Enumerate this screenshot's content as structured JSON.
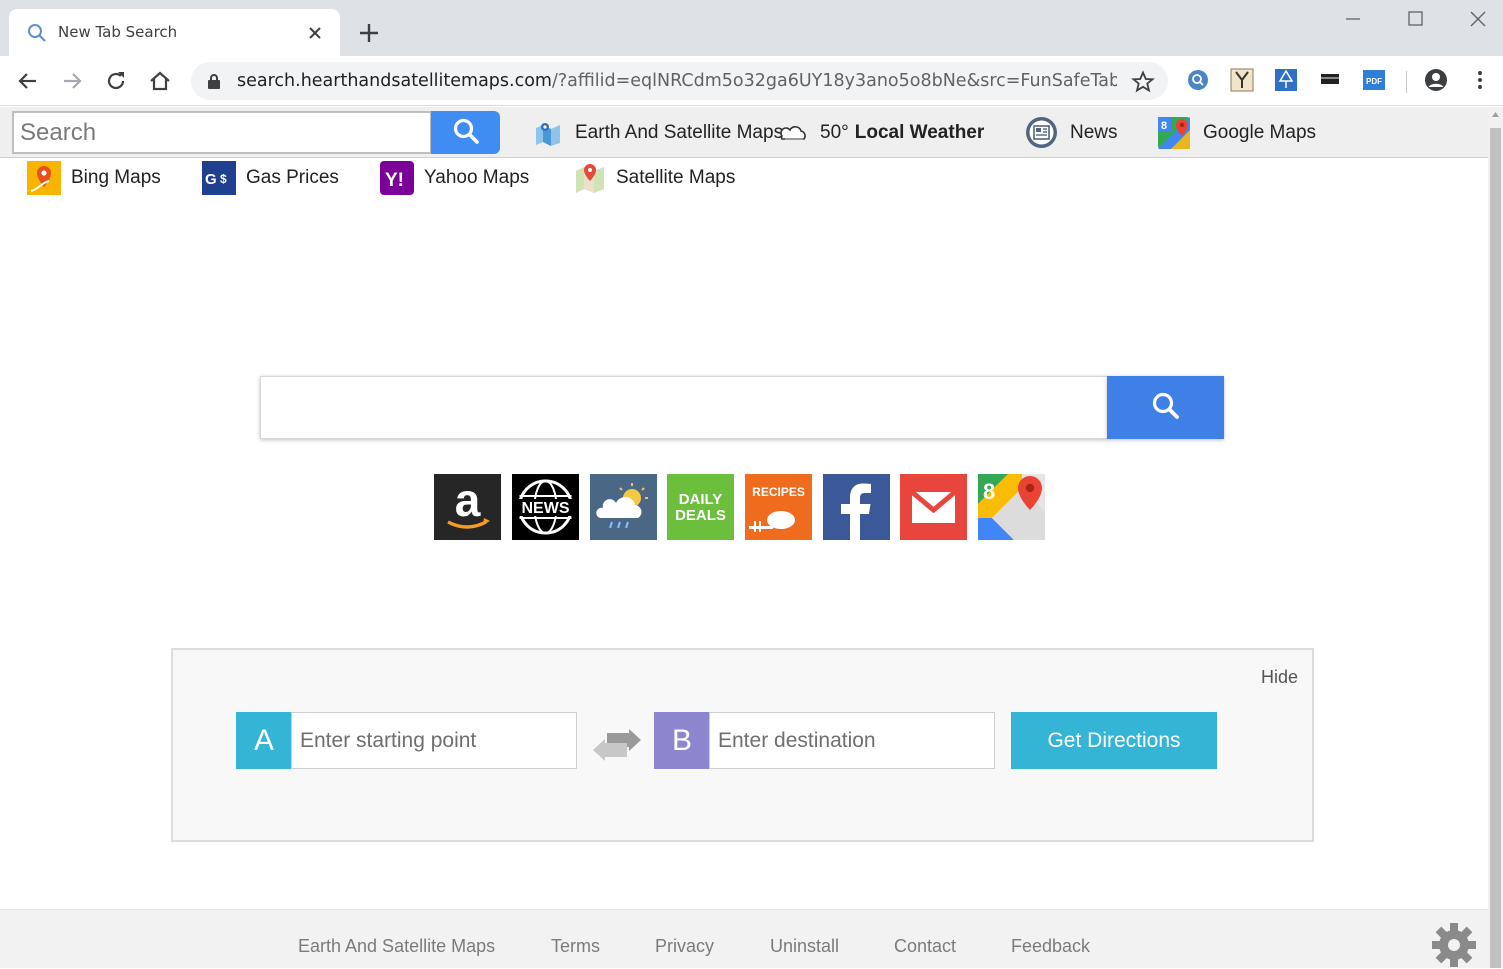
{
  "browser": {
    "tab_title": "New Tab Search",
    "url_main": "search.hearthandsatellitemaps.com",
    "url_rest": "/?affilid=eqlNRCdm5o32ga6UY18y3ano5o8bNe&src=FunSafeTab_..."
  },
  "topbar": {
    "search_placeholder": "Search",
    "links": [
      {
        "label": "Earth And Satellite Maps"
      },
      {
        "temp": "50°",
        "label": "Local Weather"
      },
      {
        "label": "News"
      },
      {
        "label": "Google Maps"
      }
    ]
  },
  "links_row2": [
    {
      "label": "Bing Maps"
    },
    {
      "label": "Gas Prices"
    },
    {
      "label": "Yahoo Maps"
    },
    {
      "label": "Satellite Maps"
    }
  ],
  "tiles": [
    {
      "icon": "amazon-icon"
    },
    {
      "icon": "news-icon",
      "text": "NEWS"
    },
    {
      "icon": "weather-icon"
    },
    {
      "icon": "daily-deals-icon",
      "text1": "DAILY",
      "text2": "DEALS"
    },
    {
      "icon": "recipes-icon",
      "text": "RECIPES"
    },
    {
      "icon": "facebook-icon"
    },
    {
      "icon": "gmail-icon"
    },
    {
      "icon": "google-maps-icon"
    }
  ],
  "directions": {
    "hide_label": "Hide",
    "badge_a": "A",
    "badge_b": "B",
    "start_placeholder": "Enter starting point",
    "dest_placeholder": "Enter destination",
    "button_label": "Get Directions",
    "colors": {
      "a": "#35b5d6",
      "b": "#8c86cf",
      "button": "#35b5d6"
    }
  },
  "footer": {
    "links": [
      "Earth And Satellite Maps",
      "Terms",
      "Privacy",
      "Uninstall",
      "Contact",
      "Feedback"
    ]
  },
  "colors": {
    "search_button": "#3f80e6",
    "topbar_bg": "#efefef"
  }
}
